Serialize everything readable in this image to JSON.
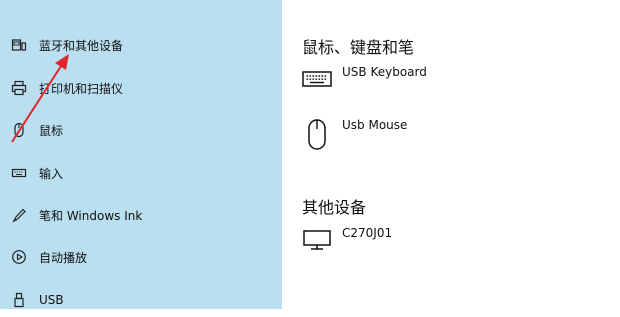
{
  "sidebar": {
    "items": [
      {
        "label": "蓝牙和其他设备",
        "icon": "bluetooth-devices-icon"
      },
      {
        "label": "打印机和扫描仪",
        "icon": "printer-icon"
      },
      {
        "label": "鼠标",
        "icon": "mouse-icon"
      },
      {
        "label": "输入",
        "icon": "keyboard-icon"
      },
      {
        "label": "笔和 Windows Ink",
        "icon": "pen-icon"
      },
      {
        "label": "自动播放",
        "icon": "autoplay-icon"
      },
      {
        "label": "USB",
        "icon": "usb-icon"
      }
    ]
  },
  "main": {
    "section_mouse_keyboard": {
      "title": "鼠标、键盘和笔",
      "devices": [
        {
          "name": "USB Keyboard",
          "icon": "keyboard-icon"
        },
        {
          "name": "Usb Mouse",
          "icon": "mouse-icon"
        }
      ]
    },
    "section_other": {
      "title": "其他设备",
      "devices": [
        {
          "name": "C270J01",
          "icon": "monitor-icon"
        }
      ]
    }
  },
  "colors": {
    "sidebar_bg": "#b9dff1",
    "annotation_arrow": "#e0262b"
  }
}
